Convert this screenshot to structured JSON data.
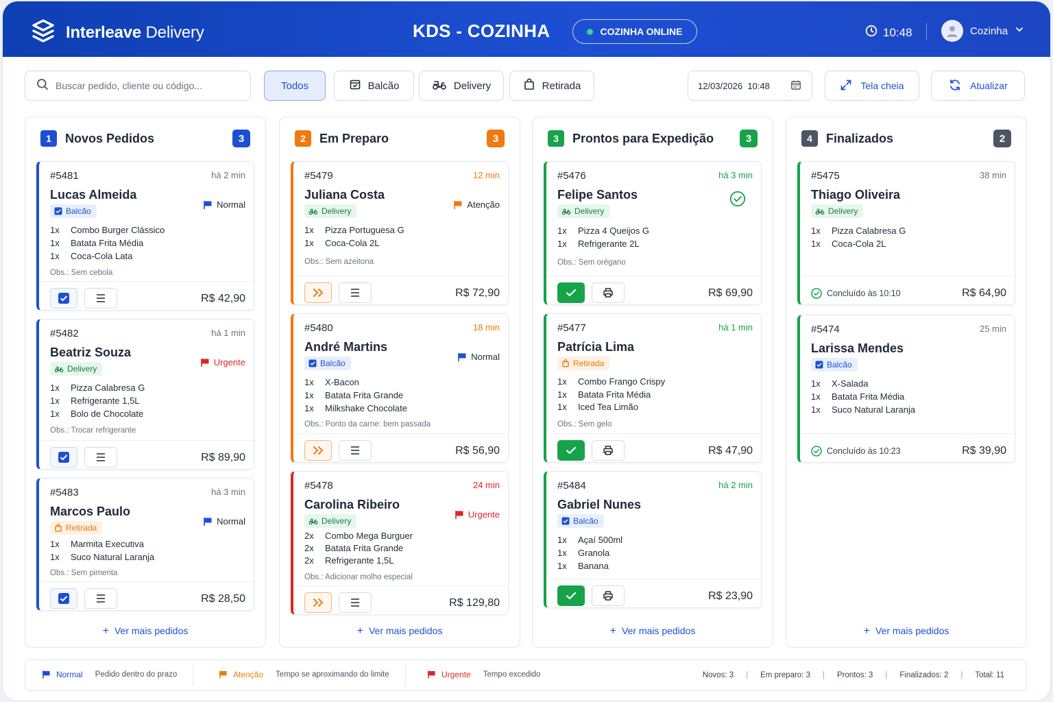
{
  "header": {
    "brand_bold": "Interleave",
    "brand_rest": " Delivery",
    "title": "KDS - COZINHA",
    "status": "COZINHA ONLINE",
    "clock": "10:48",
    "user": "Cozinha"
  },
  "toolbar": {
    "search_placeholder": "Buscar pedido, cliente ou código...",
    "filters": [
      "Todos",
      "Balcão",
      "Delivery",
      "Retirada"
    ],
    "date": "12/03/2026",
    "time": "10:48",
    "fullscreen": "Tela cheia",
    "refresh": "Atualizar"
  },
  "more_label": "Ver mais pedidos",
  "columns": [
    {
      "num": "1",
      "title": "Novos Pedidos",
      "count": "3",
      "color": "#1d4fd3",
      "cards": [
        {
          "id": "#5481",
          "time": "há 2 min",
          "name": "Lucas Almeida",
          "tag": "Balcão",
          "prio": "Normal",
          "items": [
            [
              "1x",
              "Combo Burger Clássico"
            ],
            [
              "1x",
              "Batata Frita Média"
            ],
            [
              "1x",
              "Coca-Cola Lata"
            ]
          ],
          "obs": "Obs.: Sem cebola",
          "price": "R$ 42,90"
        },
        {
          "id": "#5482",
          "time": "há 1 min",
          "name": "Beatriz Souza",
          "tag": "Delivery",
          "prio": "Urgente",
          "items": [
            [
              "1x",
              "Pizza Calabresa G"
            ],
            [
              "1x",
              "Refrigerante 1,5L"
            ],
            [
              "1x",
              "Bolo de Chocolate"
            ]
          ],
          "obs": "Obs.: Trocar refrigerante",
          "price": "R$ 89,90"
        },
        {
          "id": "#5483",
          "time": "há 3 min",
          "name": "Marcos Paulo",
          "tag": "Retirada",
          "prio": "Normal",
          "items": [
            [
              "1x",
              "Marmita Executiva"
            ],
            [
              "1x",
              "Suco Natural Laranja"
            ]
          ],
          "obs": "Obs.: Sem pimenta",
          "price": "R$ 28,50"
        }
      ]
    },
    {
      "num": "2",
      "title": "Em Preparo",
      "count": "3",
      "color": "#f07a10",
      "cards": [
        {
          "id": "#5479",
          "time": "12 min",
          "name": "Juliana Costa",
          "tag": "Delivery",
          "prio": "Atenção",
          "items": [
            [
              "1x",
              "Pizza Portuguesa G"
            ],
            [
              "1x",
              "Coca-Cola 2L"
            ]
          ],
          "obs": "Obs.: Sem azeitona",
          "price": "R$ 72,90"
        },
        {
          "id": "#5480",
          "time": "18 min",
          "name": "André Martins",
          "tag": "Balcão",
          "prio": "Normal",
          "items": [
            [
              "1x",
              "X-Bacon"
            ],
            [
              "1x",
              "Batata Frita Grande"
            ],
            [
              "1x",
              "Milkshake Chocolate"
            ]
          ],
          "obs": "Obs.: Ponto da carne: bem passada",
          "price": "R$ 56,90"
        },
        {
          "id": "#5478",
          "time": "24 min",
          "name": "Carolina Ribeiro",
          "tag": "Delivery",
          "prio": "Urgente",
          "items": [
            [
              "2x",
              "Combo Mega Burguer"
            ],
            [
              "2x",
              "Batata Frita Grande"
            ],
            [
              "2x",
              "Refrigerante 1,5L"
            ]
          ],
          "obs": "Obs.: Adicionar molho especial",
          "price": "R$ 129,80"
        }
      ]
    },
    {
      "num": "3",
      "title": "Prontos para Expedição",
      "count": "3",
      "color": "#16a34a",
      "cards": [
        {
          "id": "#5476",
          "time": "há 3 min",
          "name": "Felipe Santos",
          "tag": "Delivery",
          "items": [
            [
              "1x",
              "Pizza 4 Queijos G"
            ],
            [
              "1x",
              "Refrigerante 2L"
            ]
          ],
          "obs": "Obs.: Sem orégano",
          "price": "R$ 69,90"
        },
        {
          "id": "#5477",
          "time": "há 1 min",
          "name": "Patrícia Lima",
          "tag": "Retirada",
          "items": [
            [
              "1x",
              "Combo Frango Crispy"
            ],
            [
              "1x",
              "Batata Frita Média"
            ],
            [
              "1x",
              "Iced Tea Limão"
            ]
          ],
          "obs": "Obs.: Sem gelo",
          "price": "R$ 47,90"
        },
        {
          "id": "#5484",
          "time": "há 2 min",
          "name": "Gabriel Nunes",
          "tag": "Balcão",
          "items": [
            [
              "1x",
              "Açaí 500ml"
            ],
            [
              "1x",
              "Granola"
            ],
            [
              "1x",
              "Banana"
            ]
          ],
          "obs": "",
          "price": "R$ 23,90"
        }
      ]
    },
    {
      "num": "4",
      "title": "Finalizados",
      "count": "2",
      "color": "#4b5563",
      "cards": [
        {
          "id": "#5475",
          "time": "38 min",
          "name": "Thiago Oliveira",
          "tag": "Delivery",
          "items": [
            [
              "1x",
              "Pizza Calabresa G"
            ],
            [
              "1x",
              "Coca-Cola 2L"
            ]
          ],
          "done": "Concluído às 10:10",
          "price": "R$ 64,90"
        },
        {
          "id": "#5474",
          "time": "25 min",
          "name": "Larissa Mendes",
          "tag": "Balcão",
          "items": [
            [
              "1x",
              "X-Salada"
            ],
            [
              "1x",
              "Batata Frita Média"
            ],
            [
              "1x",
              "Suco Natural Laranja"
            ]
          ],
          "done": "Concluído às 10:23",
          "price": "R$ 39,90"
        }
      ]
    }
  ],
  "legend": [
    {
      "label": "Normal",
      "desc": "Pedido dentro do prazo",
      "color": "#1d4fd3"
    },
    {
      "label": "Atenção",
      "desc": "Tempo se aproximando do limite",
      "color": "#f07a10"
    },
    {
      "label": "Urgente",
      "desc": "Tempo excedido",
      "color": "#dc2626"
    }
  ],
  "stats": [
    "Novos: 3",
    "Em preparo: 3",
    "Prontos: 3",
    "Finalizados: 2",
    "Total: 11"
  ]
}
